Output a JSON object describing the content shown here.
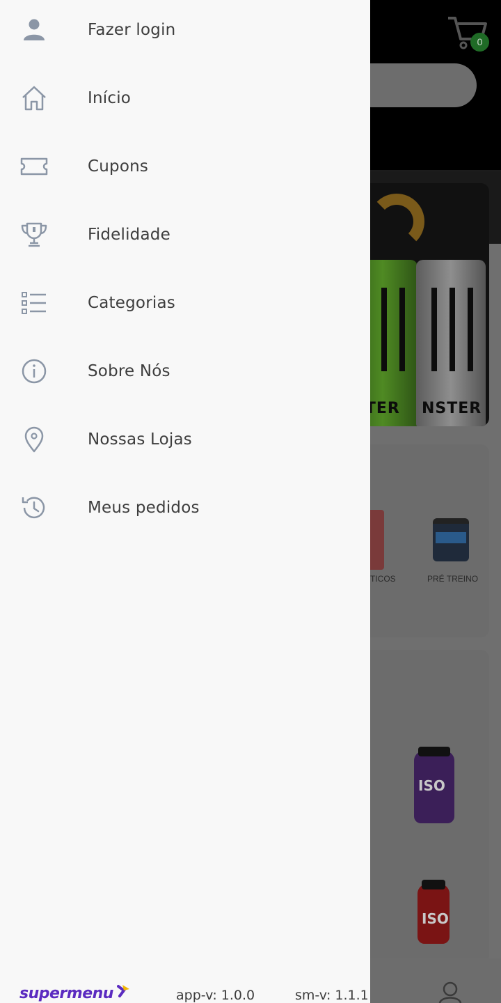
{
  "background": {
    "cart_count": "0",
    "categories": [
      "TICOS",
      "PRÉ TREINO"
    ],
    "banner_brand": [
      "STER",
      "NSTER"
    ],
    "product_labels": [
      "ISO",
      "ISO"
    ]
  },
  "drawer": {
    "items": [
      {
        "label": "Fazer login",
        "icon": "person-icon"
      },
      {
        "label": "Início",
        "icon": "home-icon"
      },
      {
        "label": "Cupons",
        "icon": "ticket-icon"
      },
      {
        "label": "Fidelidade",
        "icon": "trophy-icon"
      },
      {
        "label": "Categorias",
        "icon": "list-icon"
      },
      {
        "label": "Sobre Nós",
        "icon": "info-icon"
      },
      {
        "label": "Nossas Lojas",
        "icon": "location-pin-icon"
      },
      {
        "label": "Meus pedidos",
        "icon": "history-icon"
      }
    ],
    "footer": {
      "logo_text": "supermenu",
      "app_version": "app-v: 1.0.0",
      "sm_version": "sm-v: 1.1.1"
    }
  },
  "colors": {
    "icon": "#8b96a6",
    "text": "#3d3d3d",
    "logo_purple": "#5b2bc0",
    "logo_yellow": "#f2b705",
    "cart_badge": "#1f6b26"
  }
}
